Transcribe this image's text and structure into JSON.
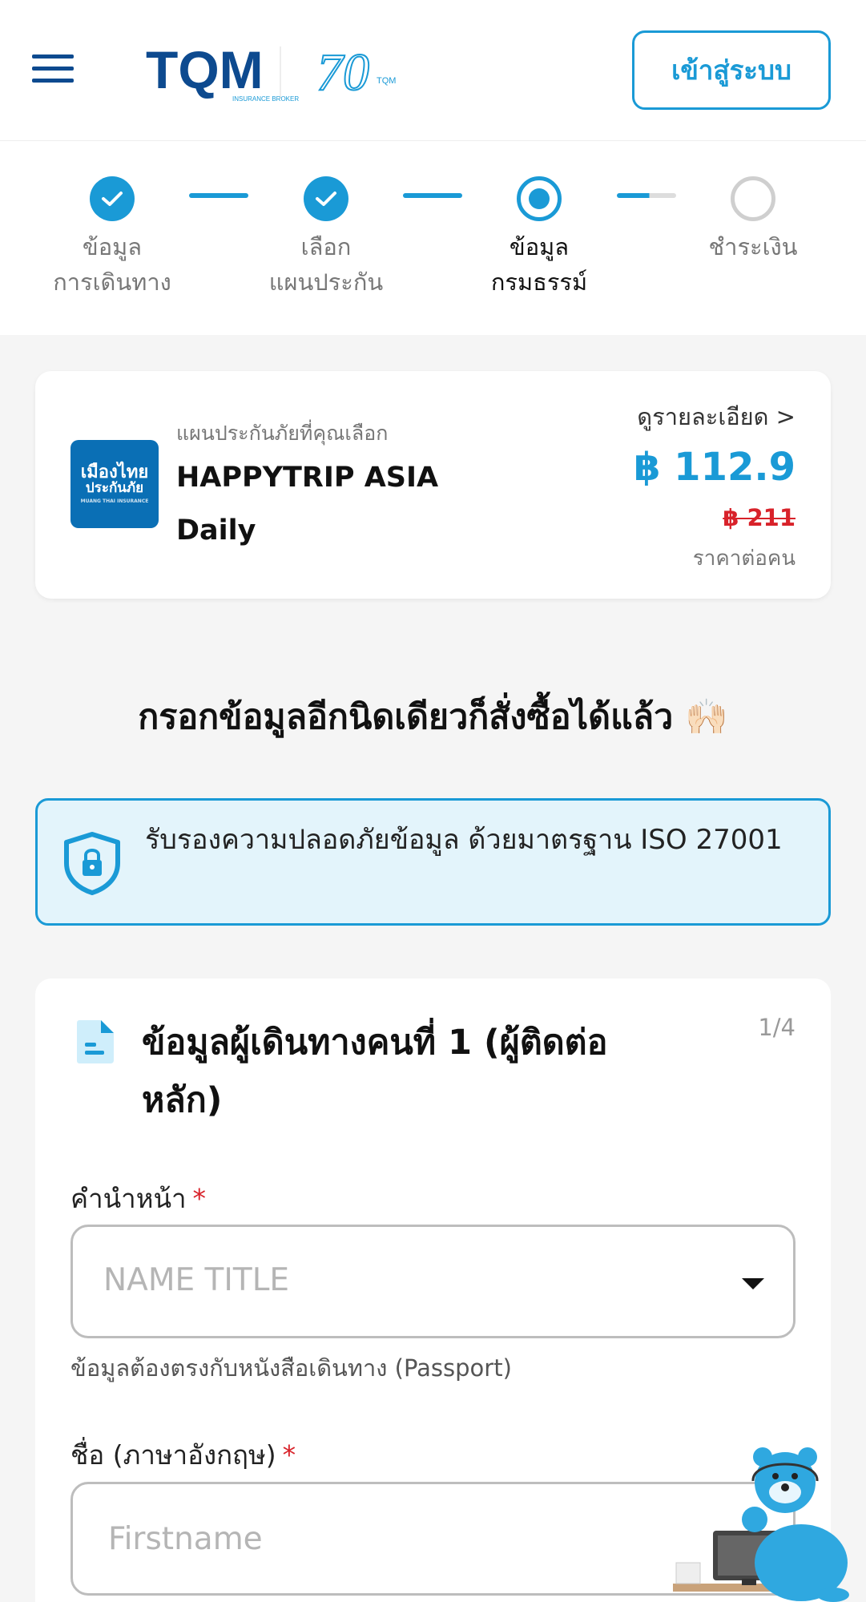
{
  "header": {
    "brand": "TQM",
    "brand_sub": "INSURANCE BROKER",
    "anniversary": "70",
    "anniversary_sub": "TQM",
    "login_label": "เข้าสู่ระบบ"
  },
  "stepper": {
    "steps": [
      {
        "line1": "ข้อมูล",
        "line2": "การเดินทาง",
        "state": "done"
      },
      {
        "line1": "เลือก",
        "line2": "แผนประกัน",
        "state": "done"
      },
      {
        "line1": "ข้อมูล",
        "line2": "กรมธรรม์",
        "state": "current"
      },
      {
        "line1": "ชำระเงิน",
        "line2": "",
        "state": "todo"
      }
    ]
  },
  "plan": {
    "insurer_logo_line1": "เมืองไทย",
    "insurer_logo_line2": "ประกันภัย",
    "insurer_logo_line3": "MUANG THAI INSURANCE",
    "caption": "แผนประกันภัยที่คุณเลือก",
    "name": "HAPPYTRIP ASIA Daily",
    "details_link": "ดูรายละเอียด >",
    "price": "฿ 112.9",
    "old_price": "฿ 211",
    "per_person": "ราคาต่อคน"
  },
  "main_heading": "กรอกข้อมูลอีกนิดเดียวก็สั่งซื้อได้แล้ว 🙌🏻",
  "security_notice": "รับรองความปลอดภัยข้อมูล ด้วยมาตรฐาน ISO 27001",
  "form": {
    "title": "ข้อมูลผู้เดินทางคนที่ 1 (ผู้ติดต่อหลัก)",
    "counter": "1/4",
    "title_label": "คำนำหน้า",
    "required_mark": "*",
    "title_placeholder": "NAME TITLE",
    "title_hint": "ข้อมูลต้องตรงกับหนังสือเดินทาง (Passport)",
    "firstname_label": "ชื่อ (ภาษาอังกฤษ)",
    "firstname_placeholder": "Firstname"
  },
  "colors": {
    "accent": "#1a9ad6",
    "brand_dark": "#0d4a8f",
    "price_old": "#d8222a",
    "notice_bg": "#e3f4fb"
  }
}
